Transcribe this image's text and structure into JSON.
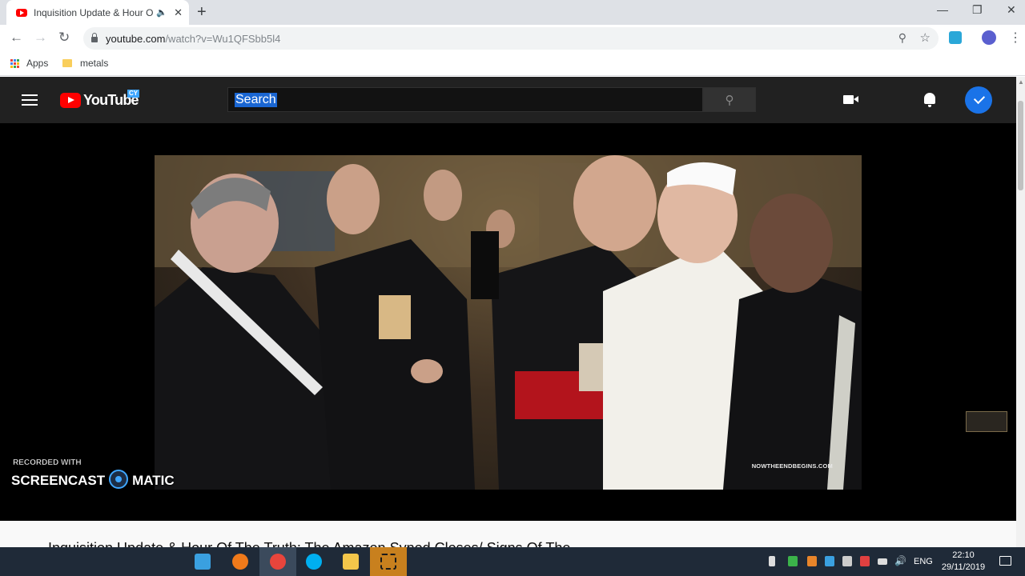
{
  "browser": {
    "tab": {
      "title": "Inquisition Update & Hour Of The Truth",
      "audio_icon": "speaker-icon",
      "close_icon": "close-icon"
    },
    "new_tab_icon": "plus-icon",
    "window_controls": [
      "minimize-icon",
      "restore-icon",
      "close-icon"
    ],
    "url": {
      "host": "youtube.com",
      "path": "/watch?v=Wu1QFSbb5l4"
    },
    "bookmarks": [
      {
        "label": "Apps",
        "icon": "apps-grid-icon"
      },
      {
        "label": "metals",
        "icon": "folder-icon"
      }
    ]
  },
  "youtube": {
    "logo_text": "YouTube",
    "country_code": "CY",
    "search": {
      "query": "Search"
    },
    "video": {
      "watermark": "NOWTHEENDBEGINS.COM",
      "title": "Inquisition Update & Hour Of The Truth: The Amazon Synod Closes/ Signs Of The"
    },
    "colors": {
      "brand_red": "#ff0000",
      "header_bg": "#212121",
      "accent_blue": "#1a73e8"
    }
  },
  "overlay": {
    "recorded_with": "RECORDED WITH",
    "brand_left": "SCREENCAST",
    "brand_right": "MATIC"
  },
  "taskbar": {
    "language": "ENG",
    "time": "22:10",
    "date": "29/11/2019"
  }
}
